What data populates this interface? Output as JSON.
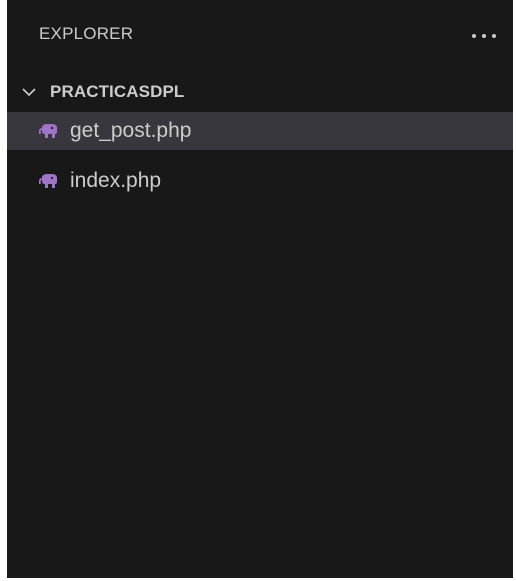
{
  "explorer": {
    "title": "EXPLORER",
    "more_icon": "ellipsis-icon"
  },
  "workspace": {
    "folder_name": "PRACTICASDPL",
    "expanded": true,
    "chevron_icon": "chevron-down-icon"
  },
  "files": [
    {
      "name": "get_post.php",
      "icon": "php-elephant-icon",
      "selected": true
    },
    {
      "name": "index.php",
      "icon": "php-elephant-icon",
      "selected": false
    }
  ],
  "colors": {
    "background": "#181818",
    "selected_row": "#37373d",
    "text": "#cccccc",
    "php_icon": "#a074c4"
  }
}
